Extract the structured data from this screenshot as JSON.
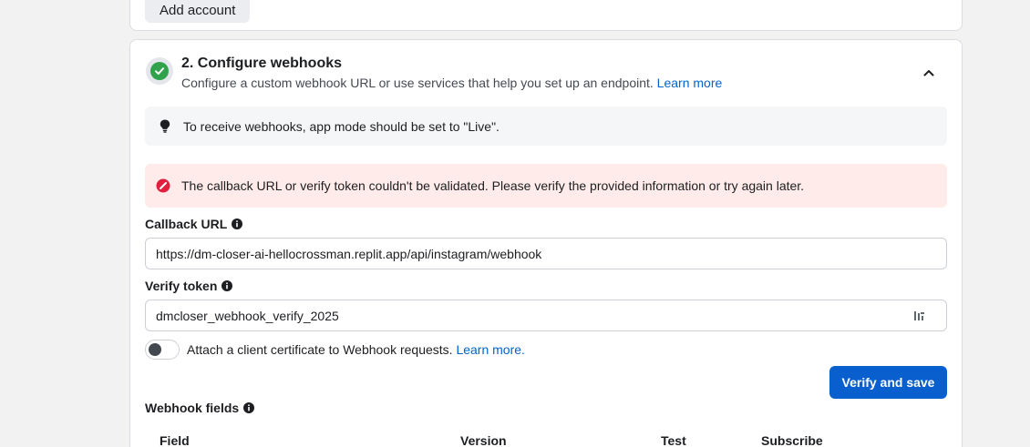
{
  "previous_step": {
    "add_account_label": "Add account"
  },
  "step": {
    "title": "2. Configure webhooks",
    "description": "Configure a custom webhook URL or use services that help you set up an endpoint.",
    "learn_more": "Learn more",
    "status_icon": "check-icon",
    "collapse_icon": "chevron-up-icon"
  },
  "info_banner": {
    "icon": "lightbulb-icon",
    "text": "To receive webhooks, app mode should be set to \"Live\"."
  },
  "error_banner": {
    "icon": "error-icon",
    "text": "The callback URL or verify token couldn't be validated. Please verify the provided information or try again later."
  },
  "callback_url": {
    "label": "Callback URL",
    "value": "https://dm-closer-ai-hellocrossman.replit.app/api/instagram/webhook"
  },
  "verify_token": {
    "label": "Verify token",
    "value": "dmcloser_webhook_verify_2025",
    "action_icon": "key-icon"
  },
  "client_certificate": {
    "label": "Attach a client certificate to Webhook requests.",
    "learn_more": "Learn more.",
    "enabled": false
  },
  "verify_save_label": "Verify and save",
  "webhook_fields": {
    "label": "Webhook fields",
    "columns": [
      "Field",
      "Version",
      "Test",
      "Subscribe"
    ]
  },
  "colors": {
    "accent": "#0a5fcf",
    "link": "#0064d1",
    "success": "#31a24c",
    "error": "#e41e3f",
    "error_bg": "#ffebe9"
  }
}
